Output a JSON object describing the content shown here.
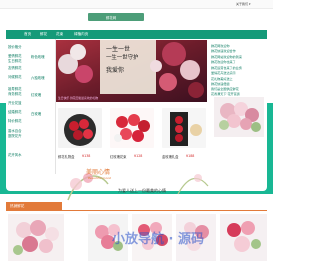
{
  "header": {
    "top_right": "关于我们 ▾",
    "logo_text": "鲜花网"
  },
  "nav": {
    "items": [
      "首页",
      "鲜花",
      "花束",
      "绿植内页"
    ]
  },
  "categories": {
    "col1": [
      "按价格分",
      "爱情鲜花",
      "生日鲜花",
      "友情鲜花",
      "问候鲜花",
      "祖寿鲜花",
      "商务鲜花",
      "开业花篮",
      "结婚鲜花",
      "特价鲜花",
      "香水百合",
      "庭院花卉",
      "花卉风水"
    ],
    "col2": [
      "粉色玫瑰",
      "六独玫瑰",
      "红玫瑰",
      "白玫瑰"
    ]
  },
  "banner": {
    "line1": "一生一世",
    "line2": "一生一世守护",
    "line3": "我爱你",
    "caption": "生日快乐·鲜花闺蜜最喜欢的礼物"
  },
  "news": {
    "items": [
      "鲜花网欢迎你",
      "鲜花快递欢迎合作",
      "鲜花网站欢迎你的到来",
      "鲜花欢迎你也来了",
      "鲜花运营也来了的业务",
      "爱情花卉送达演示",
      "花礼物美好送上",
      "鲜花快递便捷",
      "我们是全国供应鲜花",
      "花香满天下·花开富贵"
    ]
  },
  "products": [
    {
      "name": "鲜花礼物盒",
      "price": "¥138"
    },
    {
      "name": "红玫瑰花束",
      "price": "¥128"
    },
    {
      "name": "金玫瑰礼盒",
      "price": "¥188"
    }
  ],
  "product_button": "购买",
  "flower_banner": {
    "title": "美丽心情",
    "subtitle": "Beautiful mood",
    "slogan": "为爱人送上一份最美的心情"
  },
  "section": {
    "title": "热销鲜花"
  },
  "watermark": "小放导航 · 源码",
  "colors": {
    "brand": "#18b794",
    "nav": "#159a79",
    "accent": "#d42a2a",
    "orange": "#e27a3a"
  }
}
